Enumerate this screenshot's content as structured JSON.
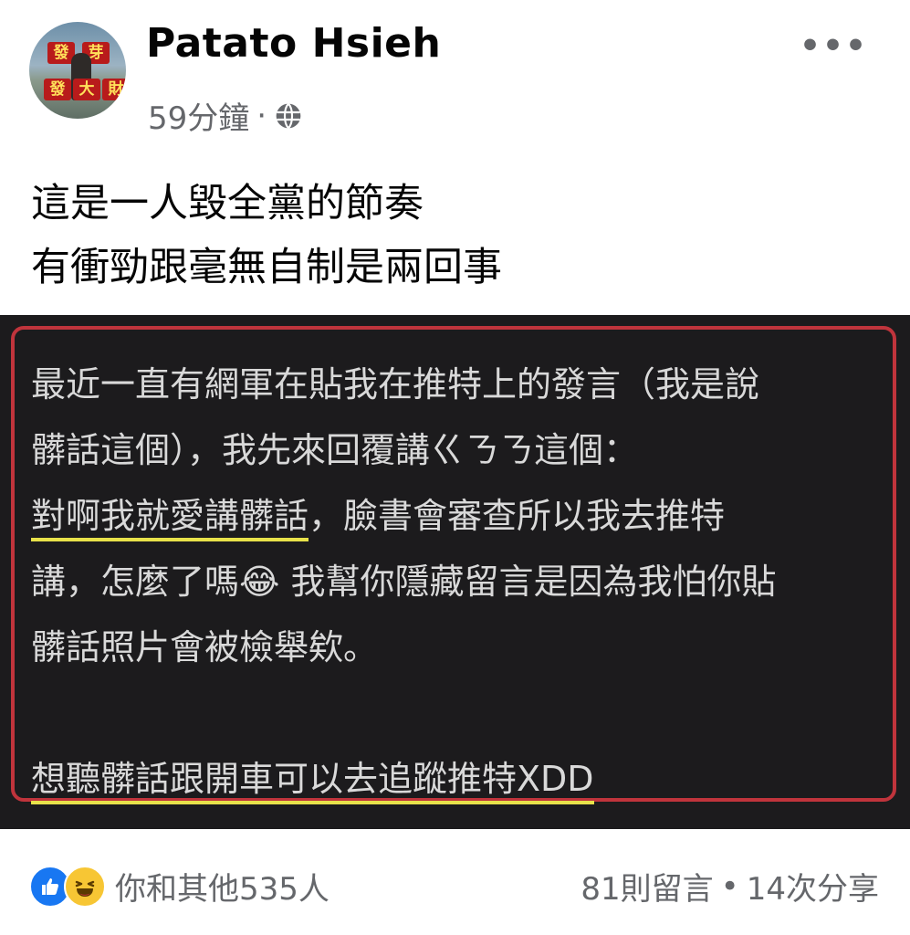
{
  "post": {
    "author": "Patato Hsieh",
    "time": "59分鐘",
    "meta_separator": "·",
    "privacy_icon": "globe-icon",
    "more_label": "•••",
    "avatar_text": [
      "發",
      "芽",
      "發",
      "大",
      "財"
    ],
    "text_lines": [
      "這是一人毀全黨的節奏",
      "有衝勁跟毫無自制是兩回事"
    ]
  },
  "image": {
    "frame_color": "#c0343c",
    "underline_color": "#e8e24a",
    "lines": [
      "最近一直有網軍在貼我在推特上的發言（我是說",
      "髒話這個），我先來回覆講ㄍㄋㄋ這個：",
      {
        "underlined": "對啊我就愛講髒話",
        "rest": "，臉書會審查所以我去推特"
      },
      {
        "before_emoji": "講，怎麼了嗎",
        "emoji": "😂",
        "after_emoji": " 我幫你隱藏留言是因為我怕你貼"
      },
      "髒話照片會被檢舉欸。",
      "",
      "想聽髒話跟開車可以去追蹤推特XDD"
    ]
  },
  "footer": {
    "reaction_icons": [
      "like-icon",
      "haha-icon"
    ],
    "reactions_text": "你和其他535人",
    "comments": "81則留言",
    "separator": "•",
    "shares": "14次分享"
  },
  "colors": {
    "like": "#1877f2",
    "haha": "#f7c634",
    "secondary_text": "#65676b",
    "image_background": "#1c1b1d"
  }
}
